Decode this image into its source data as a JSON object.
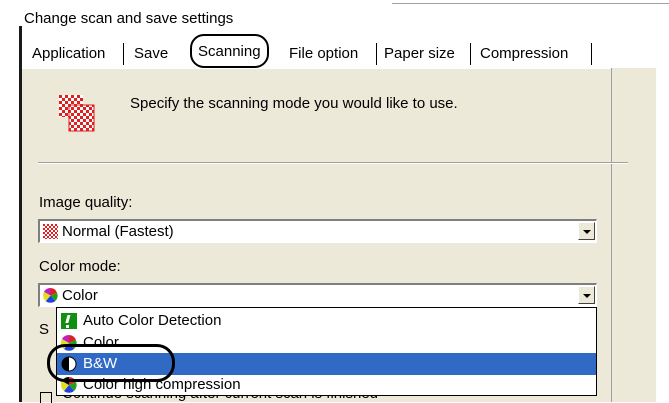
{
  "window": {
    "title": "Change scan and save settings"
  },
  "tabs": [
    {
      "label": "Application"
    },
    {
      "label": "Save"
    },
    {
      "label": "Scanning",
      "active": true
    },
    {
      "label": "File option"
    },
    {
      "label": "Paper size"
    },
    {
      "label": "Compression"
    }
  ],
  "instruction": "Specify the scanning mode you would like to use.",
  "image_quality": {
    "label": "Image quality:",
    "value": "Normal (Fastest)"
  },
  "color_mode": {
    "label": "Color mode:",
    "value": "Color",
    "options": [
      {
        "label": "Auto Color Detection",
        "icon": "auto-detect-icon"
      },
      {
        "label": "Color",
        "icon": "color-icon"
      },
      {
        "label": "B&W",
        "icon": "bw-icon",
        "selected": true
      },
      {
        "label": "Color high compression",
        "icon": "color-compression-icon"
      }
    ]
  },
  "hidden_text": {
    "partial_label": "S",
    "partial_checkbox": "Continue scanning after current scan is finished"
  },
  "colors": {
    "panel_bg": "#ece9d8",
    "selection_bg": "#316ac5",
    "selection_fg": "#ffffff"
  }
}
